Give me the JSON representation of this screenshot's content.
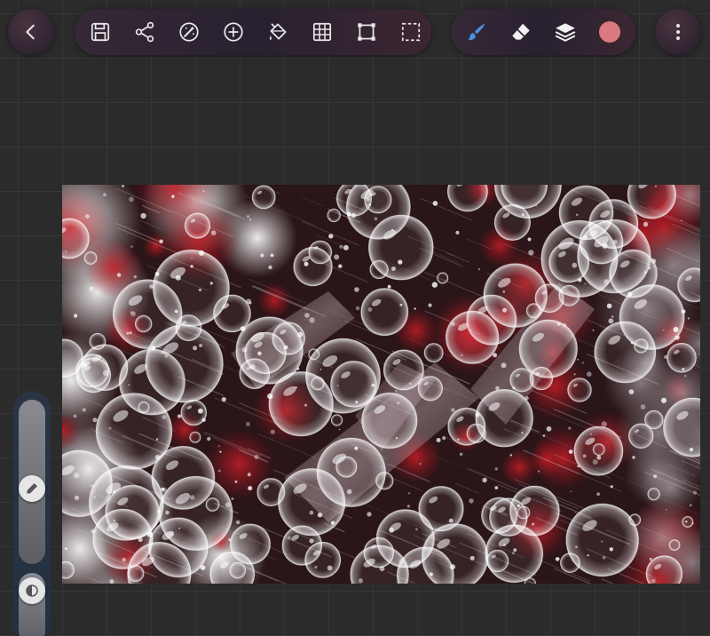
{
  "toolbar": {
    "back_icon": "chevron-left-icon",
    "file_tools": [
      "save-icon",
      "share-icon",
      "adjustments-icon",
      "add-icon",
      "fill-icon",
      "grid-icon",
      "transform-icon",
      "selection-icon"
    ],
    "draw_tools": [
      "brush-icon",
      "eraser-icon",
      "layers-icon"
    ],
    "active_tool": "brush",
    "current_color": "#d97a80",
    "more_icon": "more-vertical-icon"
  },
  "colors": {
    "background": "#2b2b2c",
    "grid_line": "#363637",
    "brush_active": "#4a90e2",
    "icon": "#e8e8e8"
  },
  "side_panel": {
    "brush_size_icon": "pencil-icon",
    "opacity_icon": "opacity-icon",
    "brush_size_level": 0.45,
    "opacity_level": 0.1
  }
}
